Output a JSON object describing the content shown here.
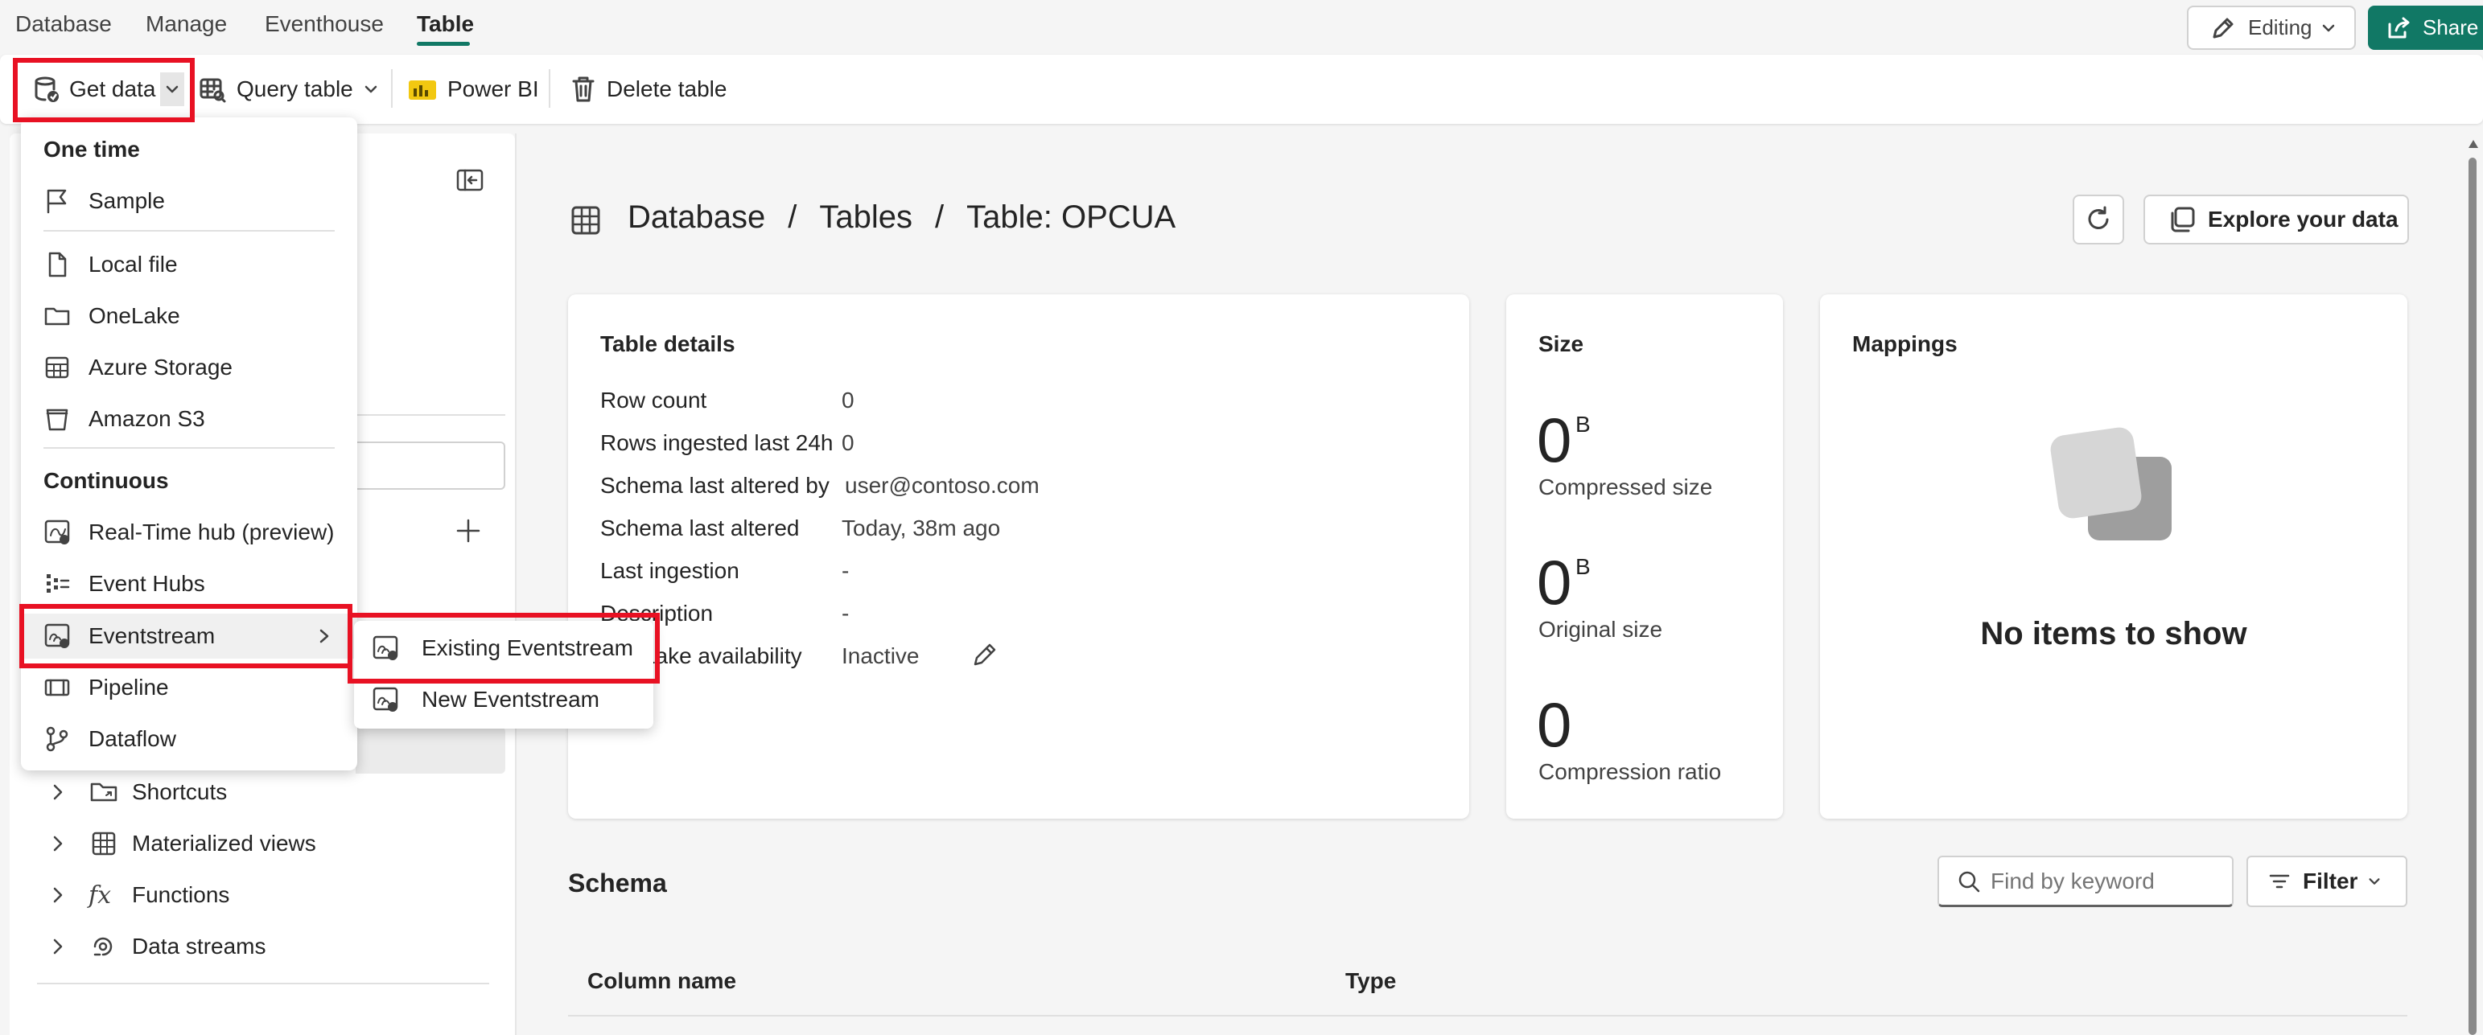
{
  "top_tabs": [
    "Database",
    "Manage",
    "Eventhouse",
    "Table"
  ],
  "active_tab": "Table",
  "editing_label": "Editing",
  "share_label": "Share",
  "ribbon": {
    "get_data": "Get data",
    "query_table": "Query table",
    "power_bi": "Power BI",
    "delete_table": "Delete table"
  },
  "get_data_menu": {
    "one_time_header": "One time",
    "sample": "Sample",
    "local_file": "Local file",
    "onelake": "OneLake",
    "azure_storage": "Azure Storage",
    "amazon_s3": "Amazon S3",
    "continuous_header": "Continuous",
    "realtime_hub": "Real-Time hub (preview)",
    "event_hubs": "Event Hubs",
    "eventstream": "Eventstream",
    "pipeline": "Pipeline",
    "dataflow": "Dataflow"
  },
  "eventstream_submenu": {
    "existing": "Existing Eventstream",
    "new": "New Eventstream"
  },
  "tree": {
    "shortcuts": "Shortcuts",
    "materialized_views": "Materialized views",
    "functions": "Functions",
    "data_streams": "Data streams"
  },
  "breadcrumb": {
    "database": "Database",
    "sep": "/",
    "tables": "Tables",
    "table": "Table: OPCUA"
  },
  "explore_label": "Explore your data",
  "table_details": {
    "title": "Table details",
    "row_count_label": "Row count",
    "row_count": "0",
    "rows_24h_label": "Rows ingested last 24h",
    "rows_24h": "0",
    "schema_by_label": "Schema last altered by",
    "schema_by": "user@contoso.com",
    "schema_altered_label": "Schema last altered",
    "schema_altered": "Today, 38m ago",
    "last_ingestion_label": "Last ingestion",
    "last_ingestion": "-",
    "description_label": "Description",
    "description": "-",
    "availability_label": "OneLake availability",
    "availability": "Inactive"
  },
  "size": {
    "title": "Size",
    "compressed_value": "0",
    "compressed_unit": "B",
    "compressed_label": "Compressed size",
    "original_value": "0",
    "original_unit": "B",
    "original_label": "Original size",
    "ratio_value": "0",
    "ratio_label": "Compression ratio"
  },
  "mappings": {
    "title": "Mappings",
    "empty": "No items to show"
  },
  "schema": {
    "title": "Schema",
    "search_placeholder": "Find by keyword",
    "filter_label": "Filter",
    "col_name": "Column name",
    "col_type": "Type"
  },
  "colors": {
    "accent": "#117865",
    "highlight": "#e81123"
  }
}
